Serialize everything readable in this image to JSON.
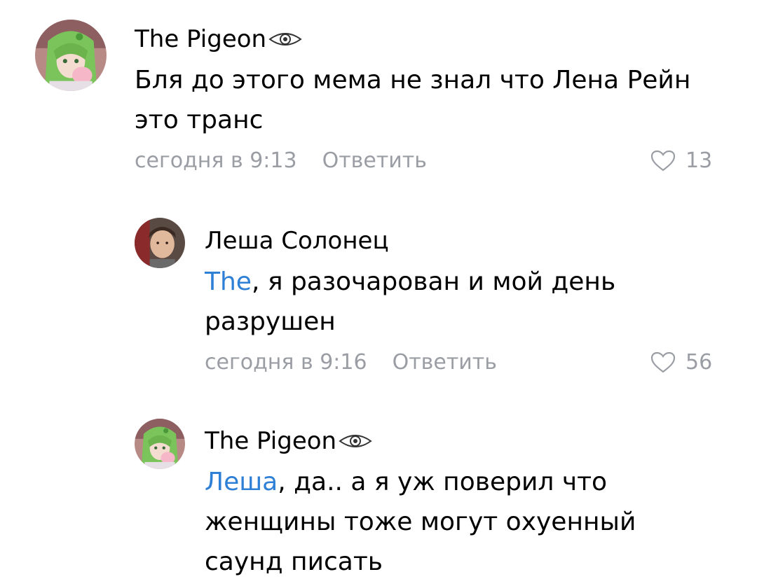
{
  "comments": [
    {
      "author": "The Pigeon",
      "author_badge_icon": "eye-icon",
      "avatar_icon": "anime-avatar",
      "text": "Бля до этого мема не знал что Лена Рейн это транс",
      "mention": "",
      "time": "сегодня в 9:13",
      "reply_label": "Ответить",
      "likes": "13"
    },
    {
      "author": "Леша Солонец",
      "author_badge_icon": "",
      "avatar_icon": "photo-avatar",
      "mention": "The",
      "text_rest": ", я разочарован и мой день разрушен",
      "time": "сегодня в 9:16",
      "reply_label": "Ответить",
      "likes": "56"
    },
    {
      "author": "The Pigeon",
      "author_badge_icon": "eye-icon",
      "avatar_icon": "anime-avatar",
      "mention": "Леша",
      "text_rest": ", да.. а я уж поверил что женщины тоже могут охуенный саунд писать"
    }
  ],
  "colors": {
    "mention": "#2e7fd6",
    "meta": "#9a9ea4",
    "text": "#000000"
  }
}
